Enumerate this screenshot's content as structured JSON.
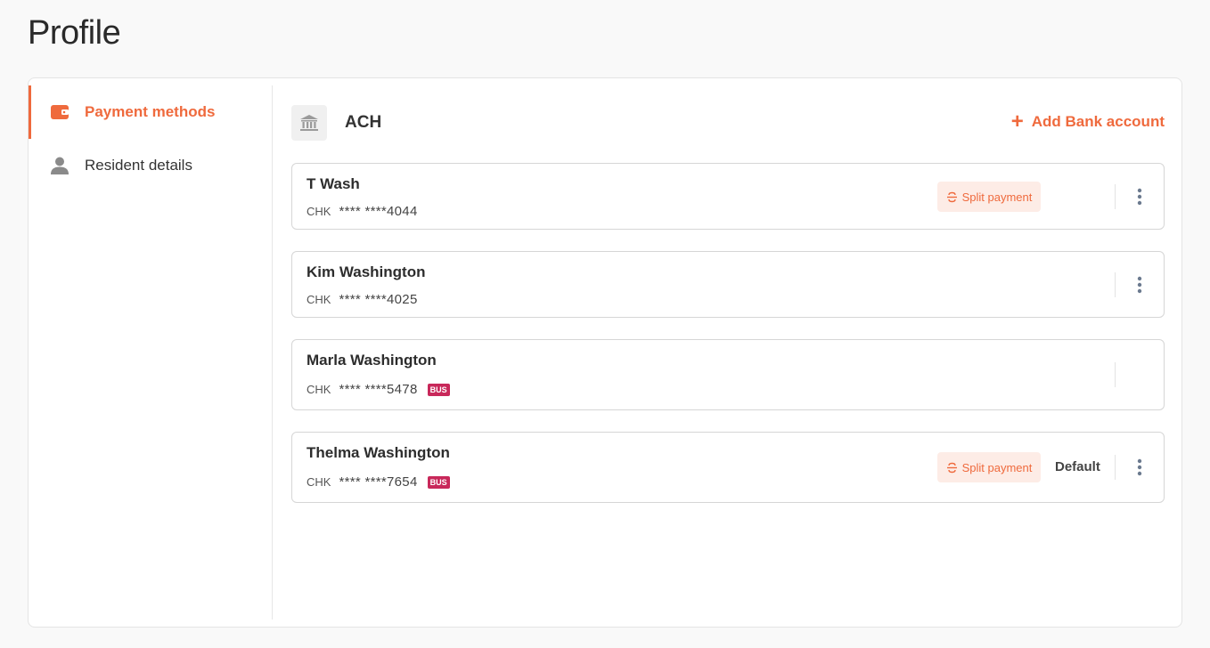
{
  "page": {
    "title": "Profile"
  },
  "sidebar": {
    "items": [
      {
        "label": "Payment methods",
        "icon": "wallet-icon",
        "active": true
      },
      {
        "label": "Resident details",
        "icon": "user-icon",
        "active": false
      }
    ]
  },
  "section": {
    "title": "ACH",
    "icon": "bank-icon",
    "add_button_label": "Add Bank account"
  },
  "accounts": [
    {
      "name": "T Wash",
      "type": "CHK",
      "mask": "**** ****4044",
      "bus": false,
      "split_payment": "Split payment",
      "default": "",
      "menu": true
    },
    {
      "name": "Kim Washington",
      "type": "CHK",
      "mask": "**** ****4025",
      "bus": false,
      "split_payment": "",
      "default": "",
      "menu": true
    },
    {
      "name": "Marla Washington",
      "type": "CHK",
      "mask": "**** ****5478",
      "bus": "BUS",
      "split_payment": "",
      "default": "",
      "menu": false
    },
    {
      "name": "Thelma Washington",
      "type": "CHK",
      "mask": "**** ****7654",
      "bus": "BUS",
      "split_payment": "Split payment",
      "default": "Default",
      "menu": true
    }
  ],
  "colors": {
    "accent": "#ef6a3d",
    "bus_badge": "#c8285a",
    "split_bg": "#fdece6"
  }
}
